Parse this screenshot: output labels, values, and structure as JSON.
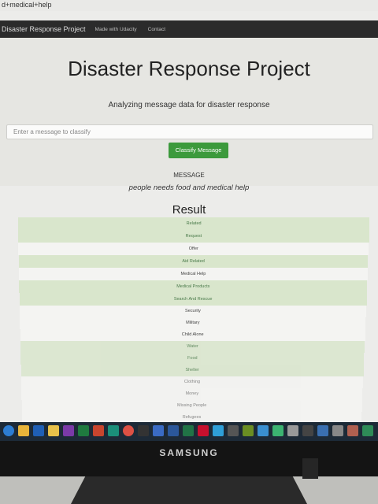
{
  "browser": {
    "address": "d+medical+help"
  },
  "navbar": {
    "brand": "Disaster Response Project",
    "links": [
      "Made with Udacity",
      "Contact"
    ]
  },
  "jumbotron": {
    "title": "Disaster Response Project",
    "subtitle": "Analyzing message data for disaster response",
    "input_placeholder": "Enter a message to classify",
    "button_label": "Classify Message",
    "message_label": "MESSAGE",
    "message_text": "people needs food and medical help"
  },
  "result": {
    "heading": "Result",
    "categories": [
      {
        "label": "Related",
        "active": true
      },
      {
        "label": "Request",
        "active": true
      },
      {
        "label": "Offer",
        "active": false
      },
      {
        "label": "Aid Related",
        "active": true
      },
      {
        "label": "Medical Help",
        "active": false
      },
      {
        "label": "Medical Products",
        "active": true
      },
      {
        "label": "Search And Rescue",
        "active": true
      },
      {
        "label": "Security",
        "active": false
      },
      {
        "label": "Military",
        "active": false
      },
      {
        "label": "Child Alone",
        "active": false
      },
      {
        "label": "Water",
        "active": true
      },
      {
        "label": "Food",
        "active": true
      },
      {
        "label": "Shelter",
        "active": true
      },
      {
        "label": "Clothing",
        "active": false
      },
      {
        "label": "Money",
        "active": false
      },
      {
        "label": "Missing People",
        "active": false
      },
      {
        "label": "Refugees",
        "active": false
      }
    ]
  },
  "taskbar": {
    "icons": [
      "edge-icon",
      "file-explorer-icon",
      "outlook-icon",
      "folder-icon",
      "onenote-icon",
      "excel-icon",
      "powerpoint-icon",
      "publisher-icon",
      "chrome-icon",
      "camera-icon",
      "task-icon",
      "word-icon",
      "excel-icon-2",
      "acrobat-icon",
      "notepad-icon",
      "calculator-icon",
      "app-icon",
      "app-icon-2",
      "app-icon-3",
      "app-icon-4",
      "app-icon-5",
      "app-icon-6",
      "app-icon-7",
      "app-icon-8",
      "app-icon-9"
    ]
  },
  "monitor": {
    "brand": "SAMSUNG"
  },
  "colors": {
    "navbar": "#2b2b2b",
    "button": "#3c9a3c",
    "active_row": "#d9e6cc",
    "inactive_row": "#f4f4f2"
  }
}
